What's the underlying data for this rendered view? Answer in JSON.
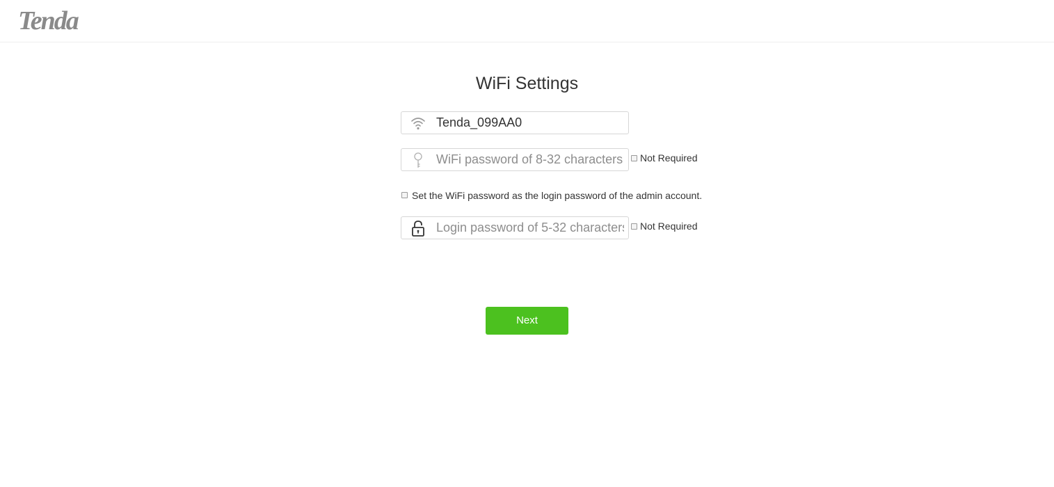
{
  "brand": {
    "logo_text": "Tenda"
  },
  "page": {
    "title": "WiFi Settings"
  },
  "form": {
    "ssid": {
      "value": "Tenda_099AA0",
      "icon": "wifi-icon"
    },
    "wifi_password": {
      "placeholder": "WiFi password of 8-32 characters",
      "icon": "key-icon",
      "not_required_label": "Not Required",
      "not_required_checked": false
    },
    "same_password": {
      "label": "Set the WiFi password as the login password of the admin account.",
      "checked": false
    },
    "login_password": {
      "placeholder": "Login password of 5-32 characters",
      "icon": "lock-icon",
      "not_required_label": "Not Required",
      "not_required_checked": false
    }
  },
  "actions": {
    "next_label": "Next"
  },
  "colors": {
    "accent": "#4cc11f",
    "logo": "#8a8a8a",
    "border": "#d6d6d6"
  }
}
